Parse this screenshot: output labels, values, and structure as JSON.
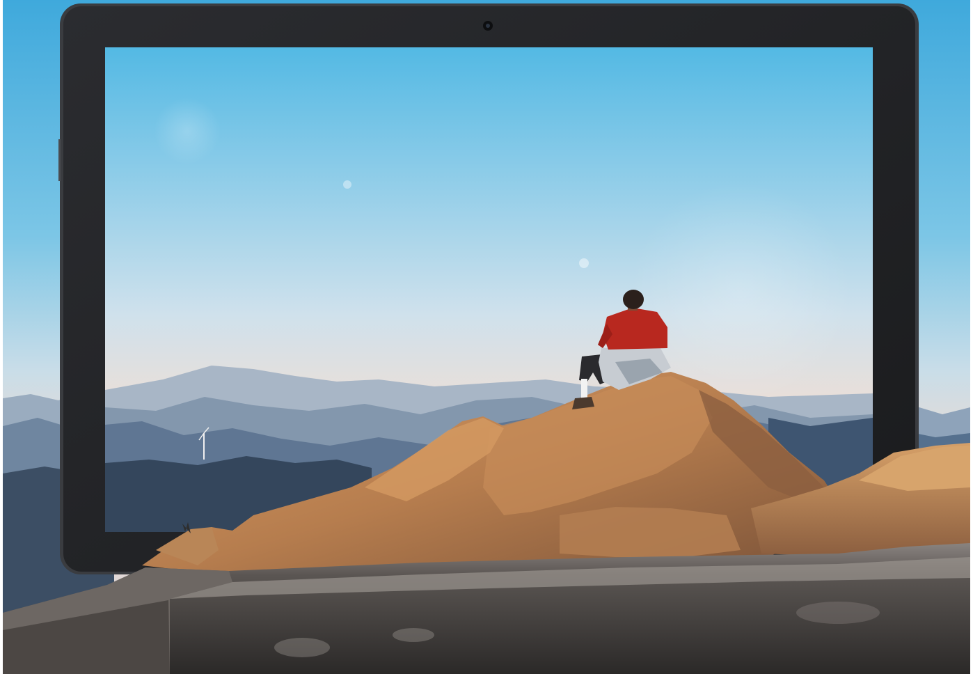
{
  "scene": {
    "subject": "tablet-mountain-hiker",
    "device": {
      "type": "tablet",
      "bezel_color": "#1e1f21",
      "frame_color": "#3a3c40",
      "camera": "front-camera"
    },
    "colors": {
      "sky_top": "#4fb6e3",
      "sky_mid": "#a9d4ea",
      "sky_horizon": "#e6ddd6",
      "haze": "#c9d3de",
      "mountain_far": "#8fa4bb",
      "mountain_mid": "#5d7591",
      "mountain_near": "#34475e",
      "rock_lit": "#c8905a",
      "rock_shadow": "#6e4a33",
      "stone_wall": "#5b5754",
      "jacket": "#b8281f",
      "pants": "#2a2a2e"
    }
  }
}
